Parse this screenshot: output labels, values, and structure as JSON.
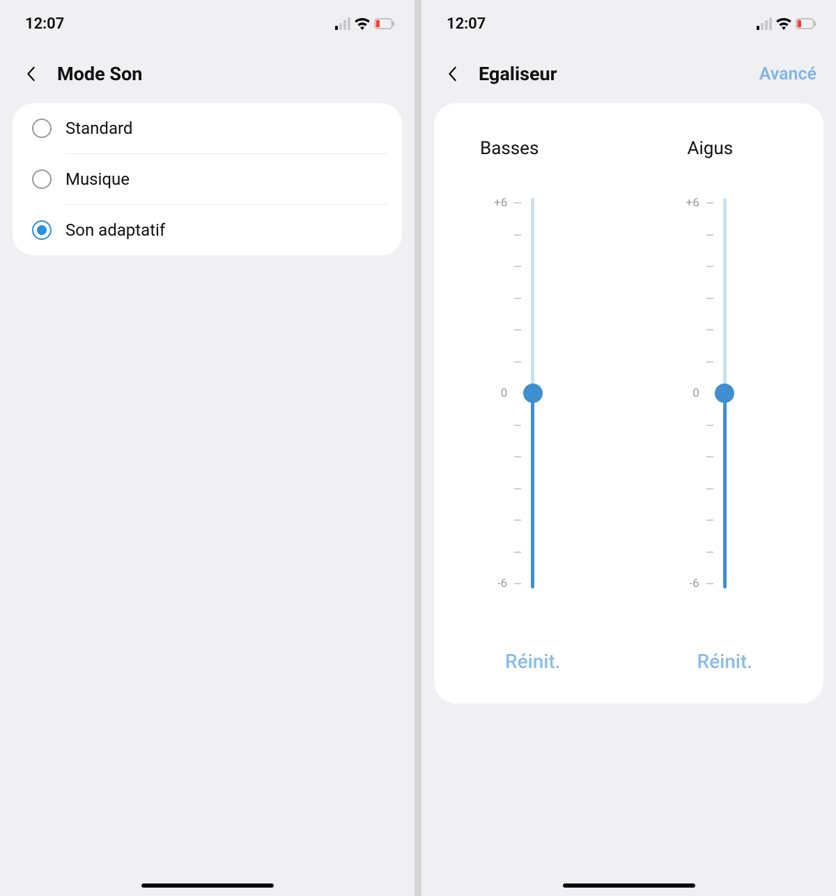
{
  "left": {
    "status": {
      "time": "12:07"
    },
    "title": "Mode Son",
    "options": [
      {
        "label": "Standard",
        "selected": false
      },
      {
        "label": "Musique",
        "selected": false
      },
      {
        "label": "Son adaptatif",
        "selected": true
      }
    ]
  },
  "right": {
    "status": {
      "time": "12:07"
    },
    "title": "Egaliseur",
    "action": "Avancé",
    "eq": {
      "range": {
        "max_label": "+6",
        "mid_label": "0",
        "min_label": "-6",
        "max": 6,
        "min": -6
      },
      "sliders": [
        {
          "name": "Basses",
          "value": 0,
          "reset": "Réinit."
        },
        {
          "name": "Aigus",
          "value": 0,
          "reset": "Réinit."
        }
      ]
    }
  }
}
